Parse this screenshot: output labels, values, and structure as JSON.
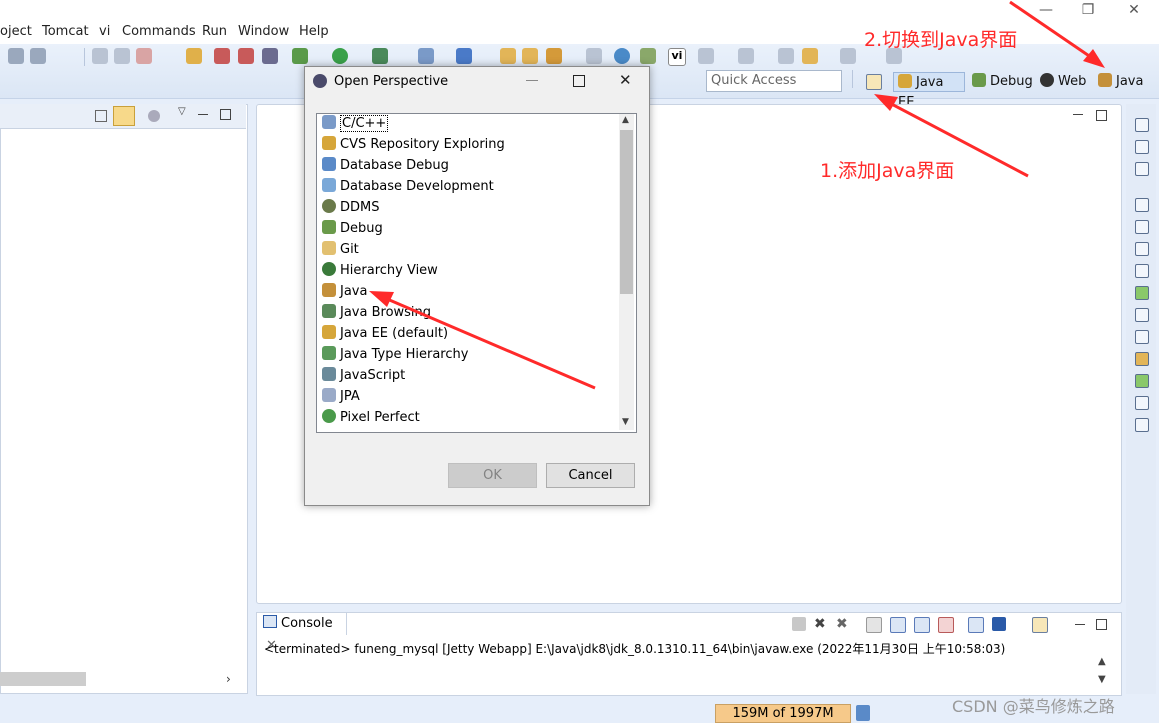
{
  "menu": {
    "items": [
      {
        "label": "oject"
      },
      {
        "label": "Tomcat"
      },
      {
        "label": "vi"
      },
      {
        "label": "Commands"
      },
      {
        "label": "Run"
      },
      {
        "label": "Window"
      },
      {
        "label": "Help"
      }
    ]
  },
  "toolbar": {
    "quick_access_placeholder": "Quick Access",
    "perspectives": [
      {
        "label": "Java EE",
        "icon": "java-ee-icon",
        "active": true
      },
      {
        "label": "Debug",
        "icon": "bug-icon"
      },
      {
        "label": "Web",
        "icon": "web-icon"
      },
      {
        "label": "Java",
        "icon": "java-icon"
      }
    ]
  },
  "annotations": {
    "switch_label": "2.切换到Java界面",
    "add_label": "1.添加Java界面",
    "color": "#ff2a2a"
  },
  "dialog": {
    "title": "Open Perspective",
    "items": [
      {
        "label": "C/C++",
        "icon": "cpp-icon"
      },
      {
        "label": "CVS Repository Exploring",
        "icon": "cvs-icon"
      },
      {
        "label": "Database Debug",
        "icon": "database-icon"
      },
      {
        "label": "Database Development",
        "icon": "database-icon"
      },
      {
        "label": "DDMS",
        "icon": "ddms-icon"
      },
      {
        "label": "Debug",
        "icon": "bug-icon"
      },
      {
        "label": "Git",
        "icon": "git-icon"
      },
      {
        "label": "Hierarchy View",
        "icon": "hierarchy-icon"
      },
      {
        "label": "Java",
        "icon": "java-icon"
      },
      {
        "label": "Java Browsing",
        "icon": "java-browsing-icon"
      },
      {
        "label": "Java EE (default)",
        "icon": "java-ee-icon"
      },
      {
        "label": "Java Type Hierarchy",
        "icon": "type-hierarchy-icon"
      },
      {
        "label": "JavaScript",
        "icon": "javascript-icon"
      },
      {
        "label": "JPA",
        "icon": "jpa-icon"
      },
      {
        "label": "Pixel Perfect",
        "icon": "magnifier-icon"
      }
    ],
    "ok_label": "OK",
    "cancel_label": "Cancel"
  },
  "console": {
    "tab_label": "Console",
    "text": "<terminated> funeng_mysql [Jetty Webapp] E:\\Java\\jdk8\\jdk_8.0.1310.11_64\\bin\\javaw.exe (2022年11月30日 上午10:58:03)"
  },
  "status": {
    "heap": "159M of 1997M"
  },
  "watermark": "CSDN @菜鸟修炼之路"
}
